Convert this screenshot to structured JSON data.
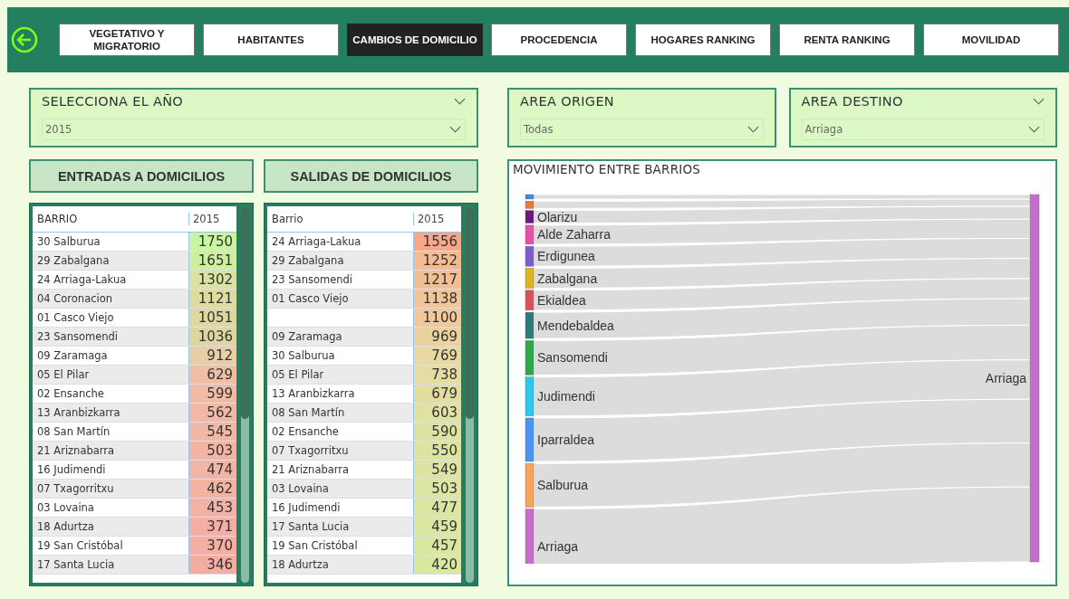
{
  "nav": {
    "tabs": [
      {
        "label": "VEGETATIVO Y MIGRATORIO",
        "selected": false
      },
      {
        "label": "HABITANTES",
        "selected": false
      },
      {
        "label": "CAMBIOS DE DOMICILIO",
        "selected": true
      },
      {
        "label": "PROCEDENCIA",
        "selected": false
      },
      {
        "label": "HOGARES RANKING",
        "selected": false
      },
      {
        "label": "RENTA RANKING",
        "selected": false
      },
      {
        "label": "MOVILIDAD",
        "selected": false
      }
    ]
  },
  "filters": [
    {
      "title": "SELECCIONA EL AÑO",
      "value": "2015",
      "header_chevron": true
    },
    {
      "title": "AREA ORIGEN",
      "value": "Todas",
      "header_chevron": false
    },
    {
      "title": "AREA DESTINO",
      "value": "Arriaga",
      "header_chevron": true
    }
  ],
  "tables": [
    {
      "title": "ENTRADAS A DOMICILIOS",
      "columns": [
        "BARRIO",
        "2015"
      ],
      "rows": [
        {
          "barrio": "30 Salburua",
          "value": "1750",
          "color": "#c8f5a0"
        },
        {
          "barrio": "29 Zabalgana",
          "value": "1651",
          "color": "#ccefa0"
        },
        {
          "barrio": "24 Arriaga-Lakua",
          "value": "1302",
          "color": "#d9e2a0"
        },
        {
          "barrio": "04 Coronacion",
          "value": "1121",
          "color": "#dcdca0"
        },
        {
          "barrio": "01 Casco Viejo",
          "value": "1051",
          "color": "#ddd8a0"
        },
        {
          "barrio": "23 Sansomendi",
          "value": "1036",
          "color": "#ded5a0"
        },
        {
          "barrio": "09 Zaramaga",
          "value": "912",
          "color": "#e6cfa4"
        },
        {
          "barrio": "05 El Pilar",
          "value": "629",
          "color": "#efbfa5"
        },
        {
          "barrio": "02 Ensanche",
          "value": "599",
          "color": "#f0bca5"
        },
        {
          "barrio": "13 Aranbizkarra",
          "value": "562",
          "color": "#f1b9a5"
        },
        {
          "barrio": "08 San Martín",
          "value": "545",
          "color": "#f1b8a5"
        },
        {
          "barrio": "21 Ariznabarra",
          "value": "503",
          "color": "#f2b5a4"
        },
        {
          "barrio": "16 Judimendi",
          "value": "474",
          "color": "#f2b4a4"
        },
        {
          "barrio": "07 Txagorritxu",
          "value": "462",
          "color": "#f2b3a4"
        },
        {
          "barrio": "03 Lovaina",
          "value": "453",
          "color": "#f3b2a4"
        },
        {
          "barrio": "18 Adurtza",
          "value": "371",
          "color": "#f4aea3"
        },
        {
          "barrio": "19 San Cristóbal",
          "value": "370",
          "color": "#f4aea3"
        },
        {
          "barrio": "17 Santa Lucia",
          "value": "346",
          "color": "#f4ada3"
        }
      ]
    },
    {
      "title": "SALIDAS DE DOMICILIOS",
      "columns": [
        "Barrio",
        "2015"
      ],
      "rows": [
        {
          "barrio": "24 Arriaga-Lakua",
          "value": "1556",
          "color": "#f5a98a"
        },
        {
          "barrio": "29 Zabalgana",
          "value": "1252",
          "color": "#f2bb92"
        },
        {
          "barrio": "23 Sansomendi",
          "value": "1217",
          "color": "#f0bf94"
        },
        {
          "barrio": "01 Casco Viejo",
          "value": "1138",
          "color": "#efc599"
        },
        {
          "barrio": "",
          "value": "1100",
          "color": "#efc89b"
        },
        {
          "barrio": "09 Zaramaga",
          "value": "969",
          "color": "#ebd0a0"
        },
        {
          "barrio": "30 Salburua",
          "value": "769",
          "color": "#e6daa2"
        },
        {
          "barrio": "05 El Pilar",
          "value": "738",
          "color": "#e4dca2"
        },
        {
          "barrio": "13 Aranbizkarra",
          "value": "679",
          "color": "#e2dea2"
        },
        {
          "barrio": "08 San Martín",
          "value": "603",
          "color": "#dfe2a2"
        },
        {
          "barrio": "02 Ensanche",
          "value": "590",
          "color": "#dee3a2"
        },
        {
          "barrio": "07 Txagorritxu",
          "value": "550",
          "color": "#dde4a2"
        },
        {
          "barrio": "21 Ariznabarra",
          "value": "549",
          "color": "#dde4a2"
        },
        {
          "barrio": "03 Lovaina",
          "value": "503",
          "color": "#dce5a1"
        },
        {
          "barrio": "16 Judimendi",
          "value": "477",
          "color": "#dbe6a1"
        },
        {
          "barrio": "17 Santa Lucia",
          "value": "459",
          "color": "#dae7a1"
        },
        {
          "barrio": "19 San Cristóbal",
          "value": "457",
          "color": "#dae7a1"
        },
        {
          "barrio": "18 Adurtza",
          "value": "420",
          "color": "#d9e8a0"
        }
      ]
    }
  ],
  "sankey": {
    "title": "MOVIMIENTO ENTRE BARRIOS",
    "sources": [
      {
        "color": "#3a8ee6"
      },
      {
        "color": "#e8783c"
      },
      {
        "label": "Olarizu",
        "color": "#6a1a7a"
      },
      {
        "label": "Alde Zaharra",
        "color": "#e452a8"
      },
      {
        "label": "Erdigunea",
        "color": "#7d5ccc"
      },
      {
        "label": "Zabalgana",
        "color": "#dcb424"
      },
      {
        "label": "Ekialdea",
        "color": "#d9525a"
      },
      {
        "label": "Mendebaldea",
        "color": "#2e7a7a"
      },
      {
        "label": "Sansomendi",
        "color": "#2ea84a"
      },
      {
        "label": "Judimendi",
        "color": "#2ec8ee"
      },
      {
        "label": "Iparraldea",
        "color": "#4a94f4"
      },
      {
        "label": "Salburua",
        "color": "#f8a45c"
      },
      {
        "label": "Arriaga",
        "color": "#c66ecc"
      }
    ],
    "target": {
      "label": "Arriaga",
      "color": "#c66ecc"
    }
  }
}
